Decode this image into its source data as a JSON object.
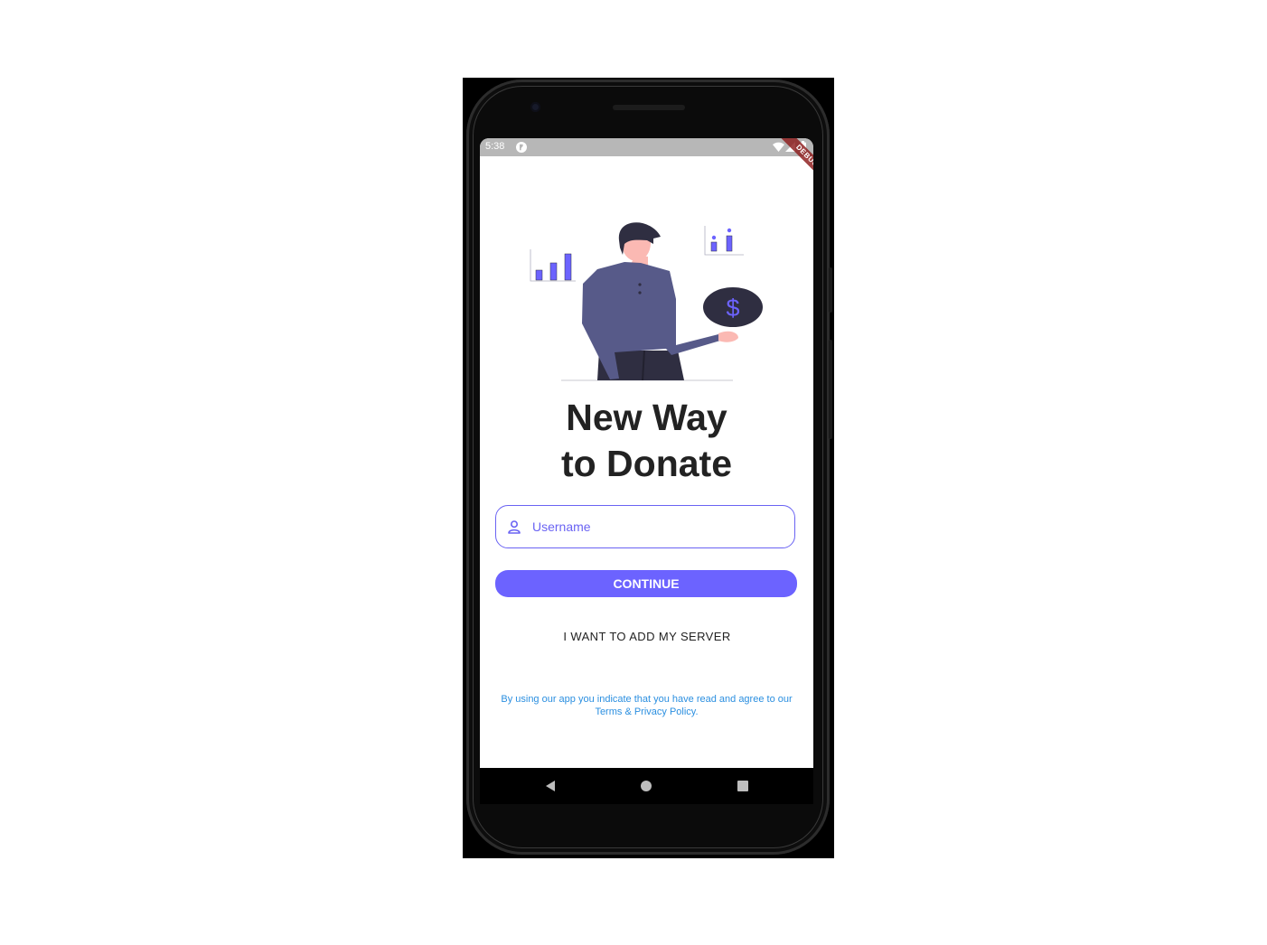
{
  "status_bar": {
    "time": "5:38",
    "app_icon": "flutter-app-icon",
    "icons": [
      "wifi-icon",
      "signal-icon",
      "battery-icon"
    ]
  },
  "debug_banner": {
    "label": "DEBUG"
  },
  "hero": {
    "icon": "person-donation-illustration",
    "currency_symbol": "$"
  },
  "headline": {
    "line1": "New Way",
    "line2": "to Donate"
  },
  "username": {
    "icon": "person-icon",
    "placeholder": "Username",
    "value": ""
  },
  "continue_button": {
    "label": "CONTINUE"
  },
  "server_button": {
    "label": "I WANT TO ADD MY SERVER"
  },
  "legal": {
    "prefix": "By using our app you indicate that you have read and agree to our ",
    "link": "Terms & Privacy Policy",
    "suffix": "."
  },
  "nav_bar": {
    "back": "back-icon",
    "home": "home-icon",
    "recents": "recents-icon"
  },
  "colors": {
    "accent": "#6c63ff",
    "headline": "#222222",
    "link": "#2b8fe0",
    "illustration_shirt": "#575a89",
    "illustration_pants": "#2f2e41"
  }
}
